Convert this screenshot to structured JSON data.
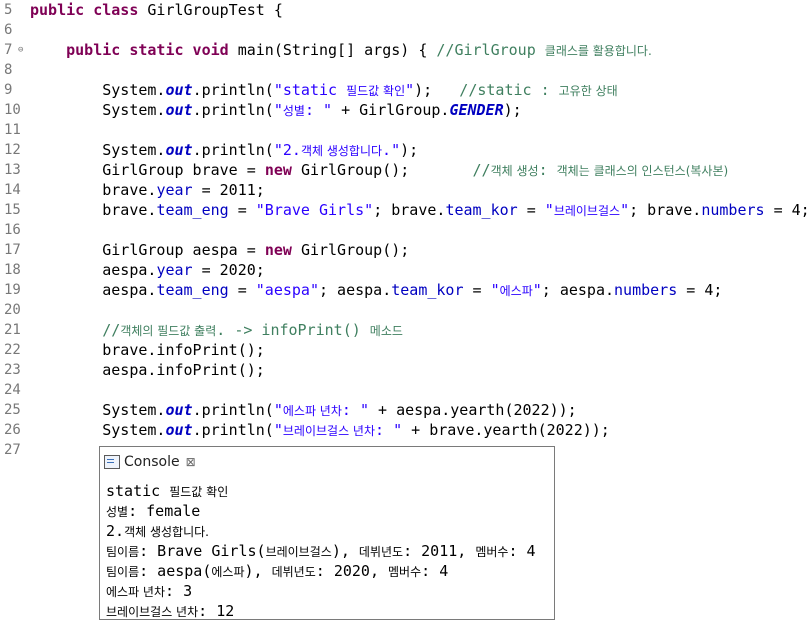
{
  "editor": {
    "lines": [
      {
        "n": "5",
        "code": [
          [
            "kw",
            "public class "
          ],
          [
            "",
            "GirlGroupTest {"
          ]
        ]
      },
      {
        "n": "6",
        "code": []
      },
      {
        "n": "7",
        "fold": "⊖",
        "code": [
          [
            "",
            "    "
          ],
          [
            "kw",
            "public static void "
          ],
          [
            "",
            "main(String[] args) { "
          ],
          [
            "cmt",
            "//GirlGroup "
          ],
          [
            "cmt ko",
            "클래스를 활용합니다."
          ]
        ]
      },
      {
        "n": "8",
        "code": []
      },
      {
        "n": "9",
        "code": [
          [
            "",
            "        System."
          ],
          [
            "sout",
            "out"
          ],
          [
            "",
            ".println("
          ],
          [
            "str",
            "\"static "
          ],
          [
            "str ko",
            "필드값 확인"
          ],
          [
            "str",
            "\""
          ],
          [
            "",
            "); "
          ],
          [
            "cmt",
            "  //static : "
          ],
          [
            "cmt ko",
            "고유한 상태"
          ]
        ]
      },
      {
        "n": "10",
        "code": [
          [
            "",
            "        System."
          ],
          [
            "sout",
            "out"
          ],
          [
            "",
            ".println("
          ],
          [
            "str",
            "\""
          ],
          [
            "str ko",
            "성별"
          ],
          [
            "str",
            ": \""
          ],
          [
            "",
            " + GirlGroup."
          ],
          [
            "sfld",
            "GENDER"
          ],
          [
            "",
            ");"
          ]
        ]
      },
      {
        "n": "11",
        "code": []
      },
      {
        "n": "12",
        "code": [
          [
            "",
            "        System."
          ],
          [
            "sout",
            "out"
          ],
          [
            "",
            ".println("
          ],
          [
            "str",
            "\"2."
          ],
          [
            "str ko",
            "객체 생성합니다"
          ],
          [
            "str",
            ".\""
          ],
          [
            "",
            ");"
          ]
        ]
      },
      {
        "n": "13",
        "code": [
          [
            "",
            "        GirlGroup brave = "
          ],
          [
            "kw",
            "new "
          ],
          [
            "",
            "GirlGroup();       "
          ],
          [
            "cmt",
            "//"
          ],
          [
            "cmt ko",
            "객체 생성"
          ],
          [
            "cmt",
            ": "
          ],
          [
            "cmt ko",
            "객체는 클래스의 인스턴스(복사본)"
          ]
        ]
      },
      {
        "n": "14",
        "code": [
          [
            "",
            "        brave."
          ],
          [
            "fld",
            "year"
          ],
          [
            "",
            " = 2011;"
          ]
        ]
      },
      {
        "n": "15",
        "code": [
          [
            "",
            "        brave."
          ],
          [
            "fld",
            "team_eng"
          ],
          [
            "",
            " = "
          ],
          [
            "str",
            "\"Brave Girls\""
          ],
          [
            "",
            "; brave."
          ],
          [
            "fld",
            "team_kor"
          ],
          [
            "",
            " = "
          ],
          [
            "str",
            "\""
          ],
          [
            "str ko",
            "브레이브걸스"
          ],
          [
            "str",
            "\""
          ],
          [
            "",
            "; brave."
          ],
          [
            "fld",
            "numbers"
          ],
          [
            "",
            " = 4;"
          ]
        ]
      },
      {
        "n": "16",
        "code": []
      },
      {
        "n": "17",
        "code": [
          [
            "",
            "        GirlGroup aespa = "
          ],
          [
            "kw",
            "new "
          ],
          [
            "",
            "GirlGroup();"
          ]
        ]
      },
      {
        "n": "18",
        "code": [
          [
            "",
            "        aespa."
          ],
          [
            "fld",
            "year"
          ],
          [
            "",
            " = 2020;"
          ]
        ]
      },
      {
        "n": "19",
        "code": [
          [
            "",
            "        aespa."
          ],
          [
            "fld",
            "team_eng"
          ],
          [
            "",
            " = "
          ],
          [
            "str",
            "\"aespa\""
          ],
          [
            "",
            "; aespa."
          ],
          [
            "fld",
            "team_kor"
          ],
          [
            "",
            " = "
          ],
          [
            "str",
            "\""
          ],
          [
            "str ko",
            "에스파"
          ],
          [
            "str",
            "\""
          ],
          [
            "",
            "; aespa."
          ],
          [
            "fld",
            "numbers"
          ],
          [
            "",
            " = 4;"
          ]
        ]
      },
      {
        "n": "20",
        "code": []
      },
      {
        "n": "21",
        "code": [
          [
            "",
            "        "
          ],
          [
            "cmt",
            "//"
          ],
          [
            "cmt ko",
            "객체의 필드값 출력"
          ],
          [
            "cmt",
            ". -> infoPrint() "
          ],
          [
            "cmt ko",
            "메소드"
          ]
        ]
      },
      {
        "n": "22",
        "code": [
          [
            "",
            "        brave.infoPrint();"
          ]
        ]
      },
      {
        "n": "23",
        "code": [
          [
            "",
            "        aespa.infoPrint();"
          ]
        ]
      },
      {
        "n": "24",
        "code": []
      },
      {
        "n": "25",
        "code": [
          [
            "",
            "        System."
          ],
          [
            "sout",
            "out"
          ],
          [
            "",
            ".println("
          ],
          [
            "str",
            "\""
          ],
          [
            "str ko",
            "에스파 년차"
          ],
          [
            "str",
            ": \""
          ],
          [
            "",
            " + aespa.yearth(2022));"
          ]
        ]
      },
      {
        "n": "26",
        "code": [
          [
            "",
            "        System."
          ],
          [
            "sout",
            "out"
          ],
          [
            "",
            ".println("
          ],
          [
            "str",
            "\""
          ],
          [
            "str ko",
            "브레이브걸스 년차"
          ],
          [
            "str",
            ": \""
          ],
          [
            "",
            " + brave.yearth(2022));"
          ]
        ]
      },
      {
        "n": "27",
        "code": []
      }
    ]
  },
  "console": {
    "tab_label": "Console",
    "close_glyph": "⊠",
    "lines": [
      [
        [
          "",
          "static "
        ],
        [
          "ko",
          "필드값 확인"
        ]
      ],
      [
        [
          "ko",
          "성별"
        ],
        [
          "",
          ": female"
        ]
      ],
      [
        [
          "",
          "2."
        ],
        [
          "ko",
          "객체 생성합니다."
        ]
      ],
      [
        [
          "ko",
          "팀이름"
        ],
        [
          "",
          ": Brave Girls("
        ],
        [
          "ko",
          "브레이브걸스"
        ],
        [
          "",
          "), "
        ],
        [
          "ko",
          "데뷔년도"
        ],
        [
          "",
          ": 2011, "
        ],
        [
          "ko",
          "멤버수"
        ],
        [
          "",
          ": 4"
        ]
      ],
      [
        [
          "ko",
          "팀이름"
        ],
        [
          "",
          ": aespa("
        ],
        [
          "ko",
          "에스파"
        ],
        [
          "",
          "), "
        ],
        [
          "ko",
          "데뷔년도"
        ],
        [
          "",
          ": 2020, "
        ],
        [
          "ko",
          "멤버수"
        ],
        [
          "",
          ": 4"
        ]
      ],
      [
        [
          "ko",
          "에스파 년차"
        ],
        [
          "",
          ": 3"
        ]
      ],
      [
        [
          "ko",
          "브레이브걸스 년차"
        ],
        [
          "",
          ": 12"
        ]
      ]
    ]
  }
}
